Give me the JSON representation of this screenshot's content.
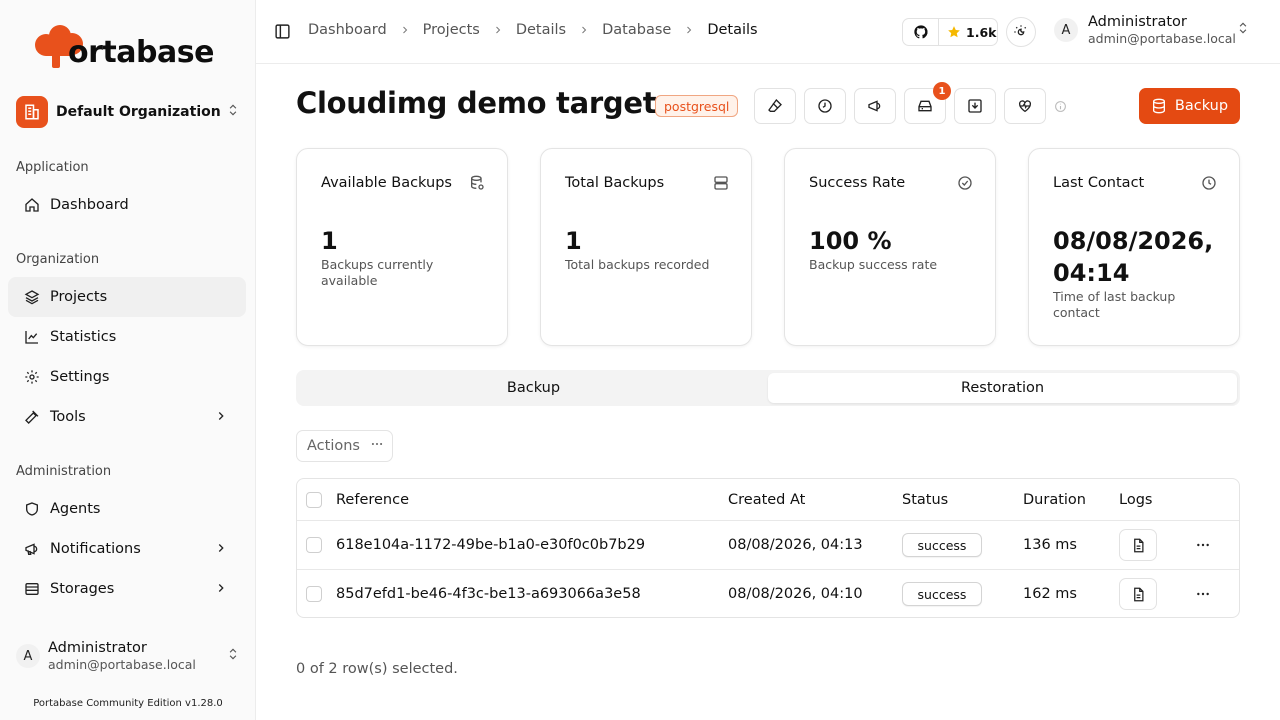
{
  "brand": {
    "logo_text": "ortabase",
    "accent": "#e8511c"
  },
  "sidebar": {
    "org_name": "Default Organization",
    "groups": {
      "application": "Application",
      "organization": "Organization",
      "administration": "Administration"
    },
    "items": {
      "dashboard": "Dashboard",
      "projects": "Projects",
      "statistics": "Statistics",
      "settings": "Settings",
      "tools": "Tools",
      "agents": "Agents",
      "notifications": "Notifications",
      "storages": "Storages"
    },
    "user": {
      "initial": "A",
      "name": "Administrator",
      "email": "admin@portabase.local"
    },
    "edition": "Portabase Community Edition v1.28.0"
  },
  "topbar": {
    "breadcrumbs": [
      "Dashboard",
      "Projects",
      "Details",
      "Database",
      "Details"
    ],
    "github_stars": "1.6k",
    "user": {
      "initial": "A",
      "name": "Administrator",
      "email": "admin@portabase.local"
    }
  },
  "page": {
    "title": "Cloudimg demo target",
    "engine_badge": "postgresql",
    "notification_count": "1",
    "backup_button": "Backup"
  },
  "cards": [
    {
      "title": "Available Backups",
      "value": "1",
      "subtitle": "Backups currently available"
    },
    {
      "title": "Total Backups",
      "value": "1",
      "subtitle": "Total backups recorded"
    },
    {
      "title": "Success Rate",
      "value": "100 %",
      "subtitle": "Backup success rate"
    },
    {
      "title": "Last Contact",
      "value": "08/08/2026, 04:14",
      "subtitle": "Time of last backup contact"
    }
  ],
  "tabs": {
    "backup": "Backup",
    "restoration": "Restoration"
  },
  "actions_label": "Actions",
  "table": {
    "headers": {
      "reference": "Reference",
      "created_at": "Created At",
      "status": "Status",
      "duration": "Duration",
      "logs": "Logs"
    },
    "rows": [
      {
        "reference": "618e104a-1172-49be-b1a0-e30f0c0b7b29",
        "created_at": "08/08/2026, 04:13",
        "status": "success",
        "duration": "136 ms"
      },
      {
        "reference": "85d7efd1-be46-4f3c-be13-a693066a3e58",
        "created_at": "08/08/2026, 04:10",
        "status": "success",
        "duration": "162 ms"
      }
    ]
  },
  "selection": "0 of 2 row(s) selected."
}
